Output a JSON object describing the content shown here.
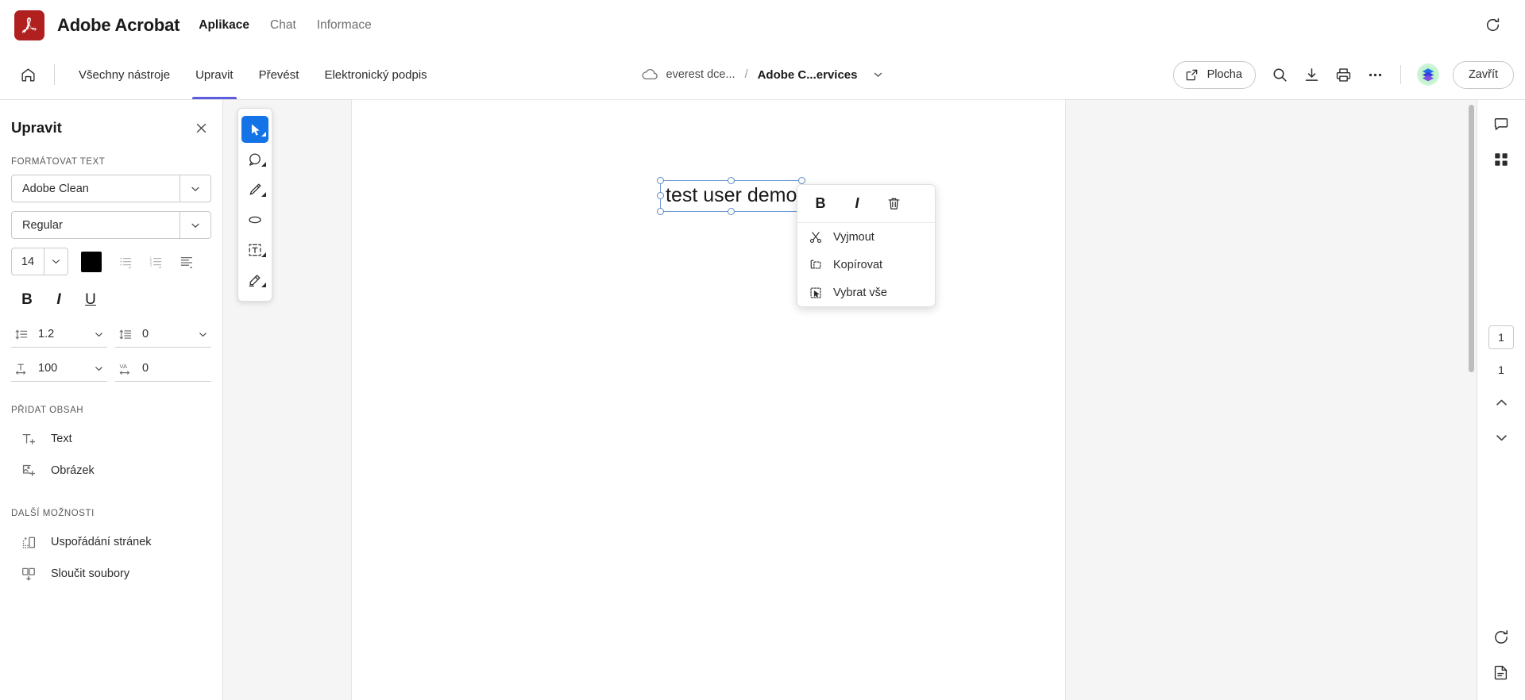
{
  "brandbar": {
    "logo_alt": "adobe-acrobat-logo",
    "title": "Adobe Acrobat",
    "nav": [
      {
        "label": "Aplikace",
        "active": true
      },
      {
        "label": "Chat",
        "active": false
      },
      {
        "label": "Informace",
        "active": false
      }
    ],
    "refresh_icon": "refresh-icon"
  },
  "toolbar": {
    "home_icon": "home-icon",
    "tabs": [
      {
        "label": "Všechny nástroje",
        "active": false
      },
      {
        "label": "Upravit",
        "active": true
      },
      {
        "label": "Převést",
        "active": false
      },
      {
        "label": "Elektronický podpis",
        "active": false
      }
    ],
    "breadcrumb": {
      "cloud_icon": "cloud-icon",
      "account": "everest dce...",
      "separator": "/",
      "document": "Adobe C...ervices",
      "chevron_icon": "chevron-down-icon"
    },
    "desktop_button": {
      "label": "Plocha",
      "icon": "open-external-icon"
    },
    "icons": [
      "search-icon",
      "download-icon",
      "print-icon",
      "more-options-icon"
    ],
    "avatar": "user-avatar",
    "close_button": "Zavřít"
  },
  "leftpanel": {
    "title": "Upravit",
    "close_icon": "close-icon",
    "format_text": {
      "label": "FORMÁTOVAT TEXT",
      "font_family": "Adobe Clean",
      "font_style": "Regular",
      "font_size": "14",
      "color": "#000000",
      "bullet_list_icon": "bulleted-list-icon",
      "number_list_icon": "numbered-list-icon",
      "align_icon": "text-align-icon",
      "bold": "B",
      "italic": "I",
      "underline": "U",
      "line_spacing_value": "1.2",
      "paragraph_spacing_value": "0",
      "horizontal_scale_value": "100",
      "tracking_label": "VA",
      "tracking_value": "0"
    },
    "add_content": {
      "label": "PŘIDAT OBSAH",
      "items": [
        {
          "label": "Text",
          "icon": "add-text-icon"
        },
        {
          "label": "Obrázek",
          "icon": "add-image-icon"
        }
      ]
    },
    "more_options": {
      "label": "DALŠÍ MOŽNOSTI",
      "items": [
        {
          "label": "Uspořádání stránek",
          "icon": "organize-pages-icon"
        },
        {
          "label": "Sloučit soubory",
          "icon": "combine-files-icon"
        }
      ]
    }
  },
  "canvas": {
    "vertical_toolbar": [
      {
        "icon": "select-cursor-icon",
        "active": true
      },
      {
        "icon": "comment-bubble-icon",
        "active": false
      },
      {
        "icon": "highlight-pen-icon",
        "active": false
      },
      {
        "icon": "draw-ellipse-icon",
        "active": false
      },
      {
        "icon": "add-text-box-icon",
        "active": false
      },
      {
        "icon": "fill-sign-icon",
        "active": false
      }
    ],
    "selected_text": "test user demo",
    "selection_color": "#6F9AD6"
  },
  "context_menu": {
    "bold": "B",
    "italic": "I",
    "delete_icon": "trash-icon",
    "items": [
      {
        "label": "Vyjmout",
        "icon": "scissors-icon"
      },
      {
        "label": "Kopírovat",
        "icon": "copy-icon"
      },
      {
        "label": "Vybrat vše",
        "icon": "select-all-icon"
      }
    ]
  },
  "rightrail": {
    "top_icons": [
      {
        "icon": "comment-panel-icon"
      },
      {
        "icon": "thumbnails-panel-icon"
      }
    ],
    "current_page": "1",
    "total_pages": "1",
    "prev_icon": "chevron-up-icon",
    "next_icon": "chevron-down-icon",
    "bottom_icons": [
      {
        "icon": "rotate-icon"
      },
      {
        "icon": "export-page-icon"
      }
    ]
  }
}
